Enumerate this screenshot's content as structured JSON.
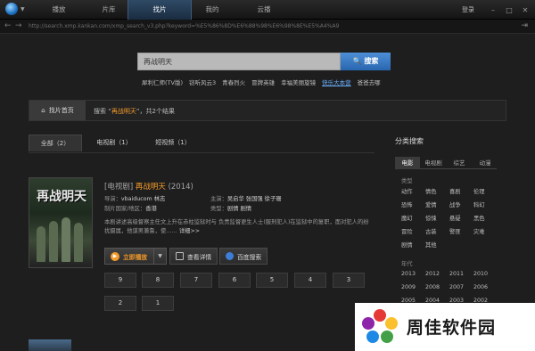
{
  "app": {
    "nav_tabs": [
      "播放",
      "片库",
      "找片",
      "我的",
      "云播"
    ],
    "active_tab": "找片",
    "login": "登录",
    "window_buttons": [
      "minimize-icon",
      "maximize-icon",
      "close-icon"
    ]
  },
  "address": {
    "url": "http://search.xmp.kankan.com/xmp_search_v3.php?keyword=%E5%86%8D%E6%88%98%E6%98%8E%E5%A4%A9"
  },
  "search": {
    "value": "再战明天",
    "button_label": "搜索",
    "hot_keywords": [
      "犀利仁师(TV版)",
      "窃听风云3",
      "青春烈火",
      "冒牌英雄",
      "幸福美丽旋镜",
      "快乐大本营",
      "爸爸去哪"
    ],
    "highlighted_keyword": "快乐大本营"
  },
  "breadcrumb": {
    "home_label": "找片首页",
    "prefix": "搜索 “",
    "keyword": "再战明天",
    "middle": "”，共",
    "count": "2",
    "suffix": "个结果"
  },
  "filter_tabs": [
    {
      "label": "全部（2）",
      "active": true
    },
    {
      "label": "电视剧（1）",
      "active": false
    },
    {
      "label": "短视频（1）",
      "active": false
    }
  ],
  "result": {
    "poster_title": "再战明天",
    "category": "[电视剧]",
    "name": "再战明天",
    "year": "(2014)",
    "director_label": "导演：",
    "director": "vbaiducom 林志",
    "cast_label": "主演：",
    "cast": "吴启华 张国强 徐子珊",
    "region_label": "制片国家/地区：",
    "region": "香港",
    "genre_label": "类型：",
    "genre": "剧情 剧情",
    "description": "本剧讲述高级督察主任文上升在赤柱监狱时与 负责监督更生人士(服刑犯人)在监狱中的复职，面对犯人的纷扰摄属，他谋男兼鲁，使……",
    "more_label": "详细>>",
    "play_label": "立即播放",
    "details_label": "查看详情",
    "baidu_label": "百度搜索",
    "episodes_row1": [
      "9",
      "8",
      "7",
      "6",
      "5",
      "4",
      "3"
    ],
    "episodes_row2": [
      "2",
      "1"
    ]
  },
  "sidebar": {
    "title": "分类搜索",
    "tabs": [
      "电影",
      "电视剧",
      "综艺",
      "动漫"
    ],
    "active_tab": "电影",
    "type_label": "类型",
    "types": [
      [
        "动作",
        "情色",
        "喜剧",
        "伦理"
      ],
      [
        "恐怖",
        "爱情",
        "战争",
        "科幻"
      ],
      [
        "魔幻",
        "惊悚",
        "悬疑",
        "黑色"
      ],
      [
        "冒险",
        "古装",
        "警匪",
        "灾难"
      ],
      [
        "剧情",
        "其他"
      ]
    ],
    "year_label": "年代",
    "years": [
      [
        "2013",
        "2012",
        "2011",
        "2010"
      ],
      [
        "2009",
        "2008",
        "2007",
        "2006"
      ],
      [
        "2005",
        "2004",
        "2003",
        "2002"
      ]
    ]
  },
  "watermark": {
    "text": "周佳软件园"
  }
}
